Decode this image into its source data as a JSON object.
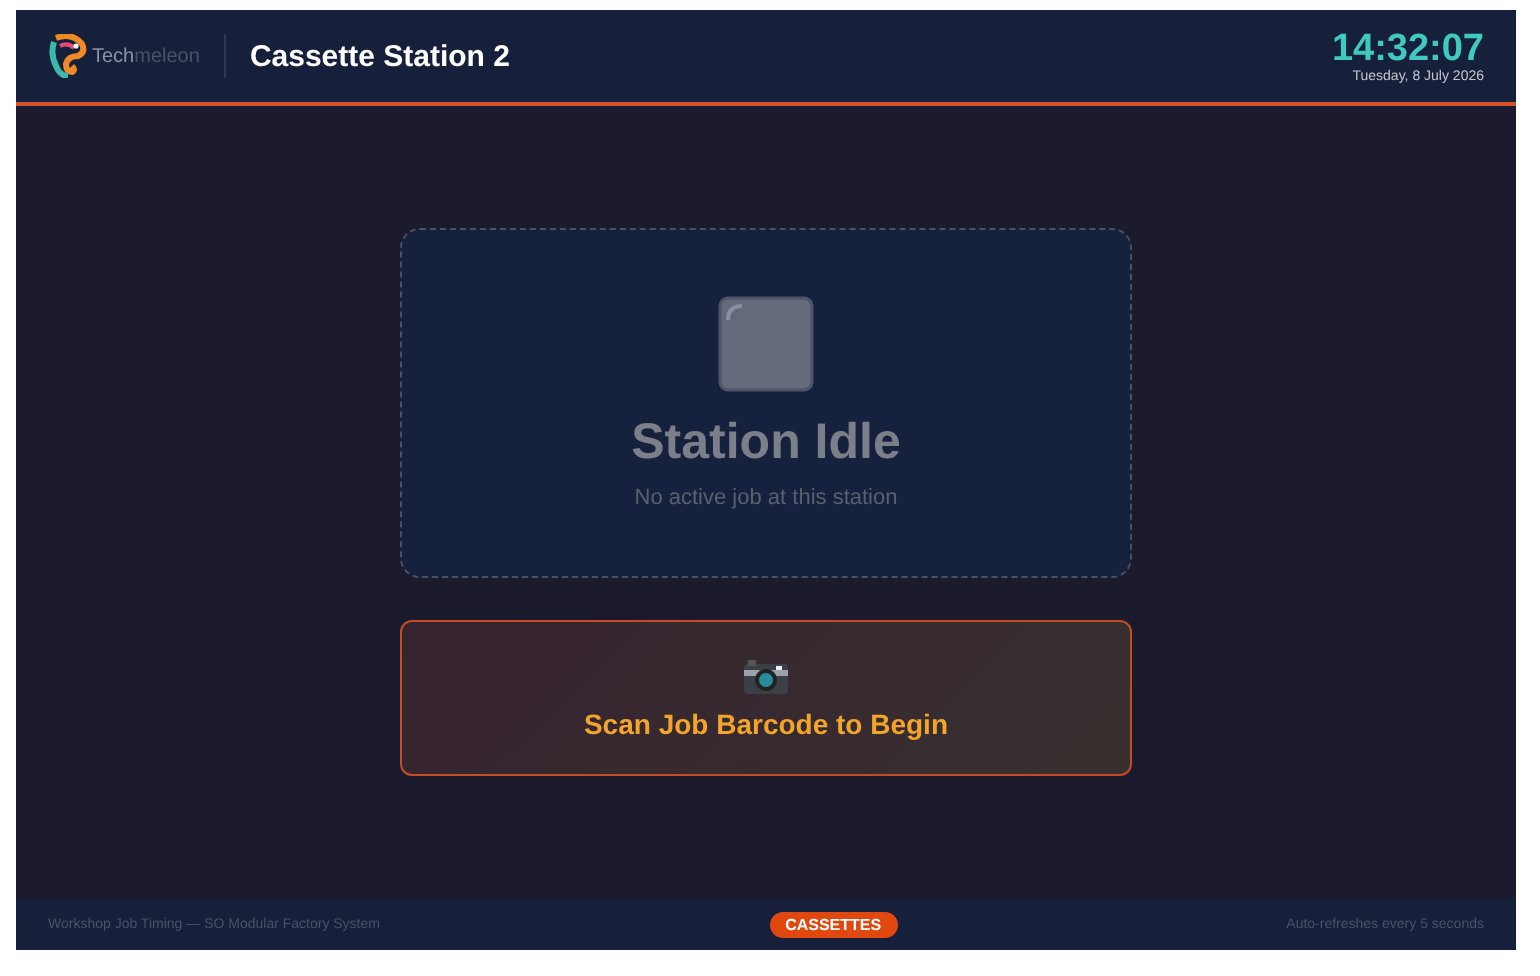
{
  "header": {
    "logo_parts": [
      "Tech",
      "meleon"
    ],
    "title": "Cassette Station 2",
    "clock": {
      "time": "14:32:07",
      "date": "Tuesday, 8 July 2026"
    }
  },
  "status_card": {
    "title": "Station Idle",
    "subtitle": "No active job at this station"
  },
  "scan_button": {
    "label": "Scan Job Barcode to Begin"
  },
  "footer": {
    "left": "Workshop Job Timing — SO Modular Factory System",
    "badge": "CASSETTES",
    "right": "Auto-refreshes every 5 seconds"
  }
}
